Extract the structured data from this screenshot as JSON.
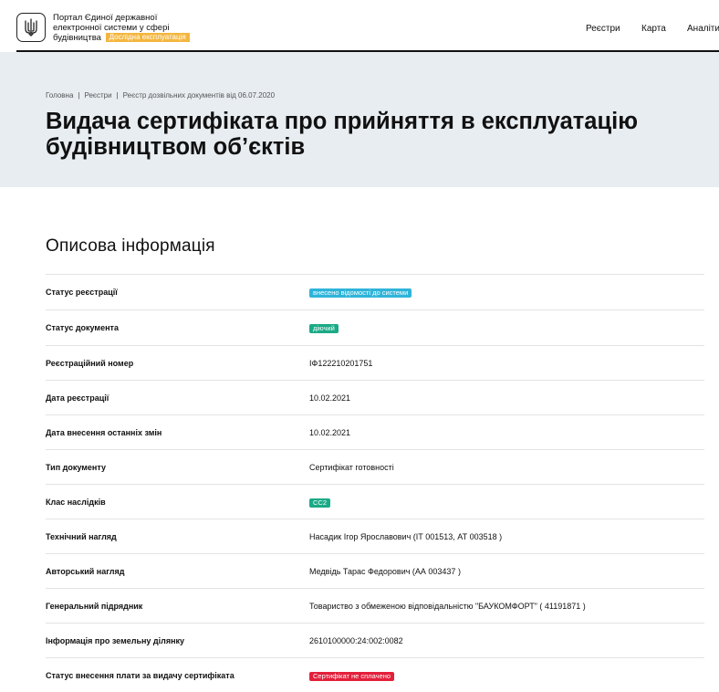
{
  "header": {
    "portal_title": "Портал Єдиної державної електронної системи у сфері будівництва",
    "beta_label": "Дослідна експлуатація",
    "nav": [
      "Реєстри",
      "Карта",
      "Аналіти"
    ]
  },
  "hero": {
    "breadcrumb": [
      "Головна",
      "Реєстри",
      "Реєстр дозвільних документів від 06.07.2020"
    ],
    "title_line1": "Видача сертифіката про прийняття в експлуатацію",
    "title_line2": "будівництвом об’єктів"
  },
  "section": {
    "title": "Описова інформація"
  },
  "rows": [
    {
      "label": "Статус реєстрації",
      "value": "внесено відомості до системи",
      "badge": "blue"
    },
    {
      "label": "Статус документа",
      "value": "діючий",
      "badge": "green"
    },
    {
      "label": "Реєстраційний номер",
      "value": "ІФ122210201751"
    },
    {
      "label": "Дата реєстрації",
      "value": "10.02.2021"
    },
    {
      "label": "Дата внесення останніх змін",
      "value": "10.02.2021"
    },
    {
      "label": "Тип документу",
      "value": "Сертифікат готовності"
    },
    {
      "label": "Клас наслідків",
      "value": "СС2",
      "badge": "green"
    },
    {
      "label": "Технічний нагляд",
      "value": "Насадик Ігор Ярославович (ІТ 001513, АТ 003518 )"
    },
    {
      "label": "Авторський нагляд",
      "value": "Медвідь Тарас Федорович (АА 003437 )"
    },
    {
      "label": "Генеральний підрядник",
      "value": "Товариство з обмеженою відповідальністю \"БАУКОМФОРТ\" ( 41191871 )"
    },
    {
      "label": "Інформація про земельну ділянку",
      "value": "2610100000:24:002:0082"
    },
    {
      "label": "Статус внесення плати за видачу сертифіката",
      "value": "Сертифікат не сплачено",
      "badge": "red"
    }
  ],
  "colors": {
    "hero_bg": "#e8edf1",
    "beta_badge": "#f3b63f",
    "badge_blue": "#2fb4d9",
    "badge_green": "#1aaa86",
    "badge_red": "#e3203b"
  },
  "icons": {
    "logo": "trident-coat-of-arms-icon"
  }
}
